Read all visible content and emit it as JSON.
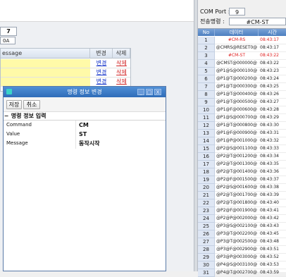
{
  "left": {
    "number_value": "7",
    "hex_value": "0A",
    "grid": {
      "headers": [
        "essage",
        "변경",
        "삭제"
      ],
      "rows": [
        {
          "edit": "변경",
          "delete": "삭제"
        },
        {
          "edit": "변경",
          "delete": "삭제"
        },
        {
          "edit": "변경",
          "delete": "삭제"
        }
      ]
    }
  },
  "dialog": {
    "title": "명령 정보 변경",
    "buttons": {
      "save": "저장",
      "cancel": "취소"
    },
    "window_controls": {
      "minimize": "_",
      "maximize": "□",
      "close": "X"
    },
    "section_title": "명령 정보 입력",
    "section_toggle": "−",
    "properties": [
      {
        "label": "Command",
        "value": "CM"
      },
      {
        "label": "Value",
        "value": "ST"
      },
      {
        "label": "Message",
        "value": "동작시작"
      }
    ]
  },
  "right": {
    "com_port_label": "COM Port :",
    "com_port_value": "9",
    "cmd_label": "전송명령 :",
    "cmd_value": "#CM-ST",
    "headers": {
      "no": "No",
      "data": "데이터",
      "time": "시간"
    },
    "rows": [
      {
        "no": "1",
        "data": "#CM-RS",
        "time": "08:43:17",
        "highlight": true
      },
      {
        "no": "2",
        "data": "@CMRS@RESET0@",
        "time": "08:43:17",
        "highlight": false
      },
      {
        "no": "3",
        "data": "#CM-ST",
        "time": "08:43:22",
        "highlight": true
      },
      {
        "no": "4",
        "data": "@CMST@000000@",
        "time": "08:43:22",
        "highlight": false
      },
      {
        "no": "5",
        "data": "@P1@S@000100@",
        "time": "08:43:23",
        "highlight": false
      },
      {
        "no": "6",
        "data": "@P1@T@000200@",
        "time": "08:43:24",
        "highlight": false
      },
      {
        "no": "7",
        "data": "@P1@T@000300@",
        "time": "08:43:25",
        "highlight": false
      },
      {
        "no": "8",
        "data": "@P1@T@000400@",
        "time": "08:43:26",
        "highlight": false
      },
      {
        "no": "9",
        "data": "@P1@T@000500@",
        "time": "08:43:27",
        "highlight": false
      },
      {
        "no": "10",
        "data": "@P1@F@000600@",
        "time": "08:43:28",
        "highlight": false
      },
      {
        "no": "11",
        "data": "@P1@S@000700@",
        "time": "08:43:29",
        "highlight": false
      },
      {
        "no": "12",
        "data": "@P1@T@000800@",
        "time": "08:43:30",
        "highlight": false
      },
      {
        "no": "13",
        "data": "@P1@F@000900@",
        "time": "08:43:31",
        "highlight": false
      },
      {
        "no": "14",
        "data": "@P1@P@001000@",
        "time": "08:43:32",
        "highlight": false
      },
      {
        "no": "15",
        "data": "@P2@S@001100@",
        "time": "08:43:33",
        "highlight": false
      },
      {
        "no": "16",
        "data": "@P2@T@001200@",
        "time": "08:43:34",
        "highlight": false
      },
      {
        "no": "17",
        "data": "@P2@T@001300@",
        "time": "08:43:35",
        "highlight": false
      },
      {
        "no": "18",
        "data": "@P2@T@001400@",
        "time": "08:43:36",
        "highlight": false
      },
      {
        "no": "19",
        "data": "@P2@F@001500@",
        "time": "08:43:37",
        "highlight": false
      },
      {
        "no": "20",
        "data": "@P2@S@001600@",
        "time": "08:43:38",
        "highlight": false
      },
      {
        "no": "21",
        "data": "@P2@T@001700@",
        "time": "08:43:39",
        "highlight": false
      },
      {
        "no": "22",
        "data": "@P2@T@001800@",
        "time": "08:43:40",
        "highlight": false
      },
      {
        "no": "23",
        "data": "@P2@F@001900@",
        "time": "08:43:41",
        "highlight": false
      },
      {
        "no": "24",
        "data": "@P2@P@002000@",
        "time": "08:43:42",
        "highlight": false
      },
      {
        "no": "25",
        "data": "@P3@S@002100@",
        "time": "08:43:43",
        "highlight": false
      },
      {
        "no": "26",
        "data": "@P3@T@002200@",
        "time": "08:43:45",
        "highlight": false
      },
      {
        "no": "27",
        "data": "@P3@T@002500@",
        "time": "08:43:48",
        "highlight": false
      },
      {
        "no": "28",
        "data": "@P3@F@002900@",
        "time": "08:43:51",
        "highlight": false
      },
      {
        "no": "29",
        "data": "@P3@P@003000@",
        "time": "08:43:52",
        "highlight": false
      },
      {
        "no": "30",
        "data": "@P4@S@003100@",
        "time": "08:43:53",
        "highlight": false
      },
      {
        "no": "31",
        "data": "@P4@T@002700@",
        "time": "08:43:59",
        "highlight": false
      }
    ]
  },
  "colors": {
    "dialog_title_bar": "#2f6cb8",
    "table_header": "#4d7fc0",
    "highlight_text": "#e02020",
    "grid_message_bg": "#fffaa8",
    "edit_link": "#1030c8",
    "delete_link": "#d02020"
  }
}
